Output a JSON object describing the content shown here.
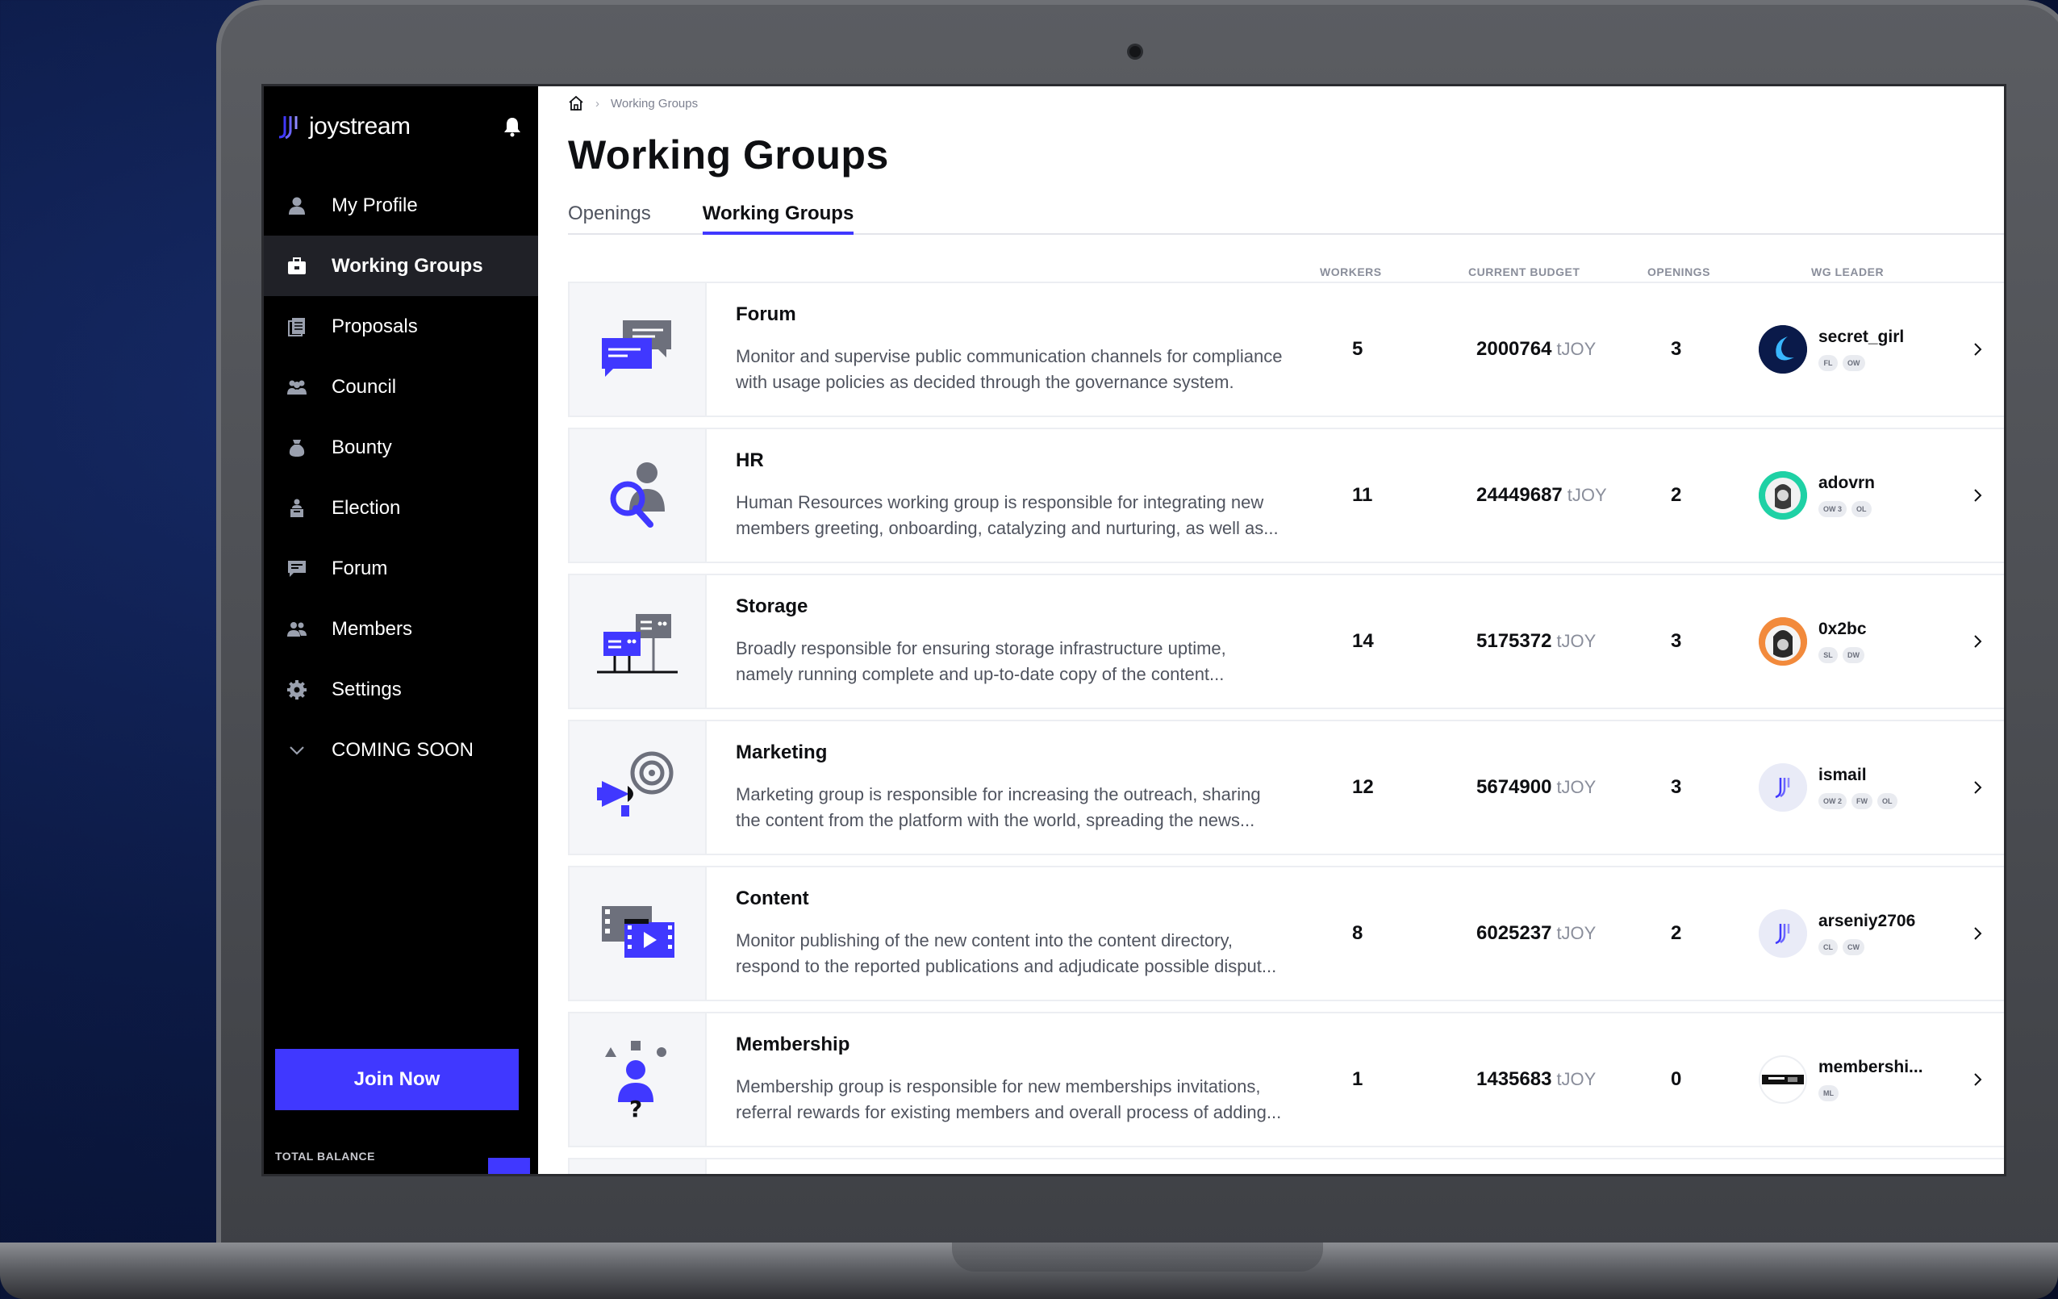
{
  "app": {
    "brand": "joystream",
    "colors": {
      "accent": "#4038ff",
      "sidebar_bg": "#000000",
      "active_item_bg": "#202127"
    }
  },
  "sidebar": {
    "bell_icon": "bell-icon",
    "items": [
      {
        "label": "My Profile",
        "icon": "user-icon",
        "active": false
      },
      {
        "label": "Working Groups",
        "icon": "briefcase-icon",
        "active": true
      },
      {
        "label": "Proposals",
        "icon": "documents-icon",
        "active": false
      },
      {
        "label": "Council",
        "icon": "group-icon",
        "active": false
      },
      {
        "label": "Bounty",
        "icon": "bounty-bag-icon",
        "active": false
      },
      {
        "label": "Election",
        "icon": "ballot-icon",
        "active": false
      },
      {
        "label": "Forum",
        "icon": "chat-icon",
        "active": false
      },
      {
        "label": "Members",
        "icon": "members-icon",
        "active": false
      },
      {
        "label": "Settings",
        "icon": "gear-icon",
        "active": false
      },
      {
        "label": "COMING SOON",
        "icon": "chevron-down-icon",
        "active": false
      }
    ],
    "join_label": "Join Now",
    "balance_label": "TOTAL BALANCE"
  },
  "breadcrumb": {
    "home_icon": "home-icon",
    "current": "Working Groups"
  },
  "page": {
    "title": "Working Groups",
    "tabs": [
      {
        "label": "Openings",
        "active": false
      },
      {
        "label": "Working Groups",
        "active": true
      }
    ]
  },
  "table": {
    "headers": {
      "workers": "WORKERS",
      "budget": "CURRENT BUDGET",
      "openings": "OPENINGS",
      "leader": "WG LEADER"
    },
    "unit": "tJOY",
    "rows": [
      {
        "title": "Forum",
        "icon": "forum-chat-illustration",
        "desc1": "Monitor and supervise public communication channels for compliance",
        "desc2": "with usage policies as decided through the governance system.",
        "workers": "5",
        "budget": "2000764",
        "openings": "3",
        "leader": "secret_girl",
        "roles": [
          "FL",
          "OW"
        ]
      },
      {
        "title": "HR",
        "icon": "hr-search-illustration",
        "desc1": "Human Resources working group is responsible for integrating new",
        "desc2": "members greeting, onboarding, catalyzing and nurturing, as well as...",
        "workers": "11",
        "budget": "24449687",
        "openings": "2",
        "leader": "adovrn",
        "roles": [
          "OW 3",
          "OL"
        ]
      },
      {
        "title": "Storage",
        "icon": "storage-servers-illustration",
        "desc1": "Broadly responsible for ensuring storage infrastructure uptime,",
        "desc2": "namely running complete and up-to-date copy of the content...",
        "workers": "14",
        "budget": "5175372",
        "openings": "3",
        "leader": "0x2bc",
        "roles": [
          "SL",
          "DW"
        ]
      },
      {
        "title": "Marketing",
        "icon": "marketing-megaphone-illustration",
        "desc1": "Marketing group is responsible for increasing the outreach, sharing",
        "desc2": "the content from the platform with the world, spreading the news...",
        "workers": "12",
        "budget": "5674900",
        "openings": "3",
        "leader": "ismail",
        "roles": [
          "OW 2",
          "FW",
          "OL"
        ]
      },
      {
        "title": "Content",
        "icon": "content-video-illustration",
        "desc1": "Monitor publishing of the new content into the content directory,",
        "desc2": "respond to the reported publications and adjudicate possible disput...",
        "workers": "8",
        "budget": "6025237",
        "openings": "2",
        "leader": "arseniy2706",
        "roles": [
          "CL",
          "CW"
        ]
      },
      {
        "title": "Membership",
        "icon": "membership-person-illustration",
        "desc1": "Membership group is responsible for new memberships invitations,",
        "desc2": "referral rewards for existing members and overall process of adding...",
        "workers": "1",
        "budget": "1435683",
        "openings": "0",
        "leader": "membershi...",
        "roles": [
          "ML"
        ]
      }
    ]
  }
}
